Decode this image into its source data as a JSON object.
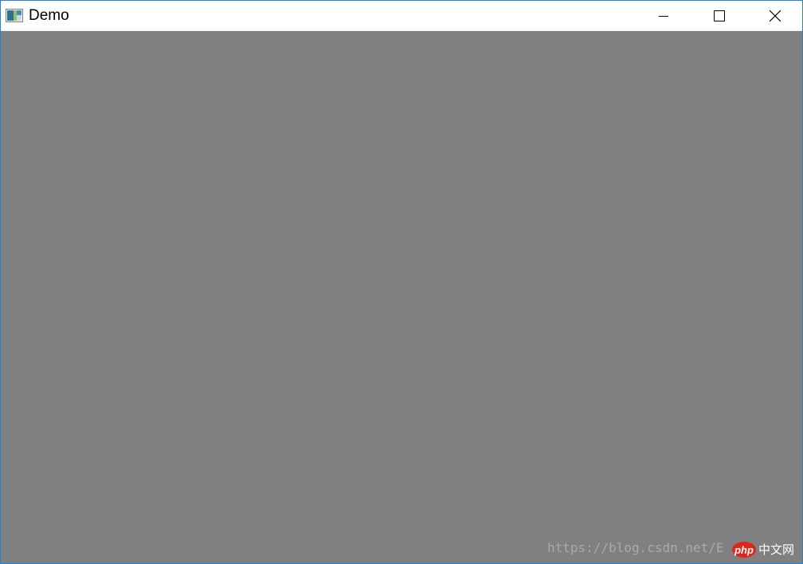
{
  "window": {
    "title": "Demo",
    "border_color": "#2b7fd4",
    "client_background": "#808080",
    "icon": "app-window-icon"
  },
  "caption_buttons": {
    "minimize": "minimize-icon",
    "maximize": "maximize-icon",
    "close": "close-icon"
  },
  "watermark": {
    "url": "https://blog.csdn.net/E",
    "logo_text": "php",
    "logo_suffix": "中文网",
    "logo_color": "#e0261c"
  }
}
